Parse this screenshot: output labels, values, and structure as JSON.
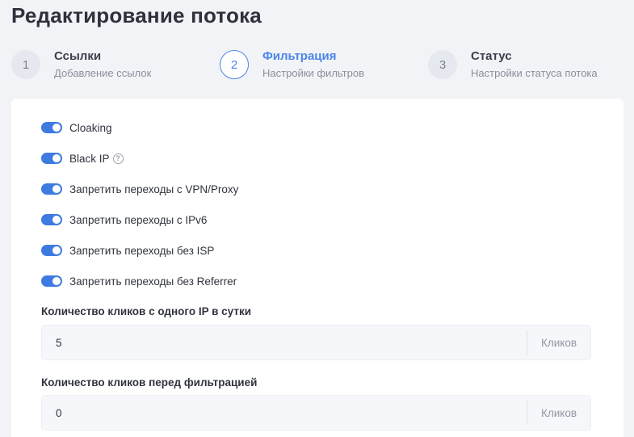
{
  "page": {
    "title": "Редактирование потока"
  },
  "stepper": {
    "steps": [
      {
        "number": "1",
        "title": "Ссылки",
        "subtitle": "Добавление ссылок"
      },
      {
        "number": "2",
        "title": "Фильтрация",
        "subtitle": "Настройки фильтров"
      },
      {
        "number": "3",
        "title": "Статус",
        "subtitle": "Настройки статуса потока"
      }
    ],
    "active_step": 2
  },
  "filters": {
    "toggles": [
      {
        "label": "Cloaking",
        "on": true
      },
      {
        "label": "Black IP",
        "on": true,
        "help_icon": "question-circle-icon"
      },
      {
        "label": "Запретить переходы с VPN/Proxy",
        "on": true
      },
      {
        "label": "Запретить переходы с IPv6",
        "on": true
      },
      {
        "label": "Запретить переходы без ISP",
        "on": true
      },
      {
        "label": "Запретить переходы без Referrer",
        "on": true
      }
    ],
    "fields": [
      {
        "label": "Количество кликов с одного IP в сутки",
        "value": "5",
        "suffix": "Кликов"
      },
      {
        "label": "Количество кликов перед фильтрацией",
        "value": "0",
        "suffix": "Кликов"
      }
    ]
  },
  "colors": {
    "accent": "#3d7be0",
    "background": "#f2f3f7",
    "card": "#ffffff"
  }
}
